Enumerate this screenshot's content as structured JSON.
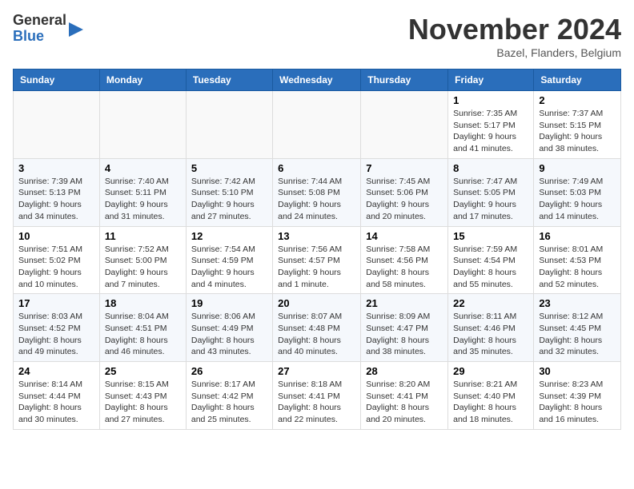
{
  "logo": {
    "line1": "General",
    "line2": "Blue"
  },
  "title": "November 2024",
  "location": "Bazel, Flanders, Belgium",
  "headers": [
    "Sunday",
    "Monday",
    "Tuesday",
    "Wednesday",
    "Thursday",
    "Friday",
    "Saturday"
  ],
  "weeks": [
    [
      {
        "day": "",
        "info": ""
      },
      {
        "day": "",
        "info": ""
      },
      {
        "day": "",
        "info": ""
      },
      {
        "day": "",
        "info": ""
      },
      {
        "day": "",
        "info": ""
      },
      {
        "day": "1",
        "info": "Sunrise: 7:35 AM\nSunset: 5:17 PM\nDaylight: 9 hours and 41 minutes."
      },
      {
        "day": "2",
        "info": "Sunrise: 7:37 AM\nSunset: 5:15 PM\nDaylight: 9 hours and 38 minutes."
      }
    ],
    [
      {
        "day": "3",
        "info": "Sunrise: 7:39 AM\nSunset: 5:13 PM\nDaylight: 9 hours and 34 minutes."
      },
      {
        "day": "4",
        "info": "Sunrise: 7:40 AM\nSunset: 5:11 PM\nDaylight: 9 hours and 31 minutes."
      },
      {
        "day": "5",
        "info": "Sunrise: 7:42 AM\nSunset: 5:10 PM\nDaylight: 9 hours and 27 minutes."
      },
      {
        "day": "6",
        "info": "Sunrise: 7:44 AM\nSunset: 5:08 PM\nDaylight: 9 hours and 24 minutes."
      },
      {
        "day": "7",
        "info": "Sunrise: 7:45 AM\nSunset: 5:06 PM\nDaylight: 9 hours and 20 minutes."
      },
      {
        "day": "8",
        "info": "Sunrise: 7:47 AM\nSunset: 5:05 PM\nDaylight: 9 hours and 17 minutes."
      },
      {
        "day": "9",
        "info": "Sunrise: 7:49 AM\nSunset: 5:03 PM\nDaylight: 9 hours and 14 minutes."
      }
    ],
    [
      {
        "day": "10",
        "info": "Sunrise: 7:51 AM\nSunset: 5:02 PM\nDaylight: 9 hours and 10 minutes."
      },
      {
        "day": "11",
        "info": "Sunrise: 7:52 AM\nSunset: 5:00 PM\nDaylight: 9 hours and 7 minutes."
      },
      {
        "day": "12",
        "info": "Sunrise: 7:54 AM\nSunset: 4:59 PM\nDaylight: 9 hours and 4 minutes."
      },
      {
        "day": "13",
        "info": "Sunrise: 7:56 AM\nSunset: 4:57 PM\nDaylight: 9 hours and 1 minute."
      },
      {
        "day": "14",
        "info": "Sunrise: 7:58 AM\nSunset: 4:56 PM\nDaylight: 8 hours and 58 minutes."
      },
      {
        "day": "15",
        "info": "Sunrise: 7:59 AM\nSunset: 4:54 PM\nDaylight: 8 hours and 55 minutes."
      },
      {
        "day": "16",
        "info": "Sunrise: 8:01 AM\nSunset: 4:53 PM\nDaylight: 8 hours and 52 minutes."
      }
    ],
    [
      {
        "day": "17",
        "info": "Sunrise: 8:03 AM\nSunset: 4:52 PM\nDaylight: 8 hours and 49 minutes."
      },
      {
        "day": "18",
        "info": "Sunrise: 8:04 AM\nSunset: 4:51 PM\nDaylight: 8 hours and 46 minutes."
      },
      {
        "day": "19",
        "info": "Sunrise: 8:06 AM\nSunset: 4:49 PM\nDaylight: 8 hours and 43 minutes."
      },
      {
        "day": "20",
        "info": "Sunrise: 8:07 AM\nSunset: 4:48 PM\nDaylight: 8 hours and 40 minutes."
      },
      {
        "day": "21",
        "info": "Sunrise: 8:09 AM\nSunset: 4:47 PM\nDaylight: 8 hours and 38 minutes."
      },
      {
        "day": "22",
        "info": "Sunrise: 8:11 AM\nSunset: 4:46 PM\nDaylight: 8 hours and 35 minutes."
      },
      {
        "day": "23",
        "info": "Sunrise: 8:12 AM\nSunset: 4:45 PM\nDaylight: 8 hours and 32 minutes."
      }
    ],
    [
      {
        "day": "24",
        "info": "Sunrise: 8:14 AM\nSunset: 4:44 PM\nDaylight: 8 hours and 30 minutes."
      },
      {
        "day": "25",
        "info": "Sunrise: 8:15 AM\nSunset: 4:43 PM\nDaylight: 8 hours and 27 minutes."
      },
      {
        "day": "26",
        "info": "Sunrise: 8:17 AM\nSunset: 4:42 PM\nDaylight: 8 hours and 25 minutes."
      },
      {
        "day": "27",
        "info": "Sunrise: 8:18 AM\nSunset: 4:41 PM\nDaylight: 8 hours and 22 minutes."
      },
      {
        "day": "28",
        "info": "Sunrise: 8:20 AM\nSunset: 4:41 PM\nDaylight: 8 hours and 20 minutes."
      },
      {
        "day": "29",
        "info": "Sunrise: 8:21 AM\nSunset: 4:40 PM\nDaylight: 8 hours and 18 minutes."
      },
      {
        "day": "30",
        "info": "Sunrise: 8:23 AM\nSunset: 4:39 PM\nDaylight: 8 hours and 16 minutes."
      }
    ]
  ]
}
